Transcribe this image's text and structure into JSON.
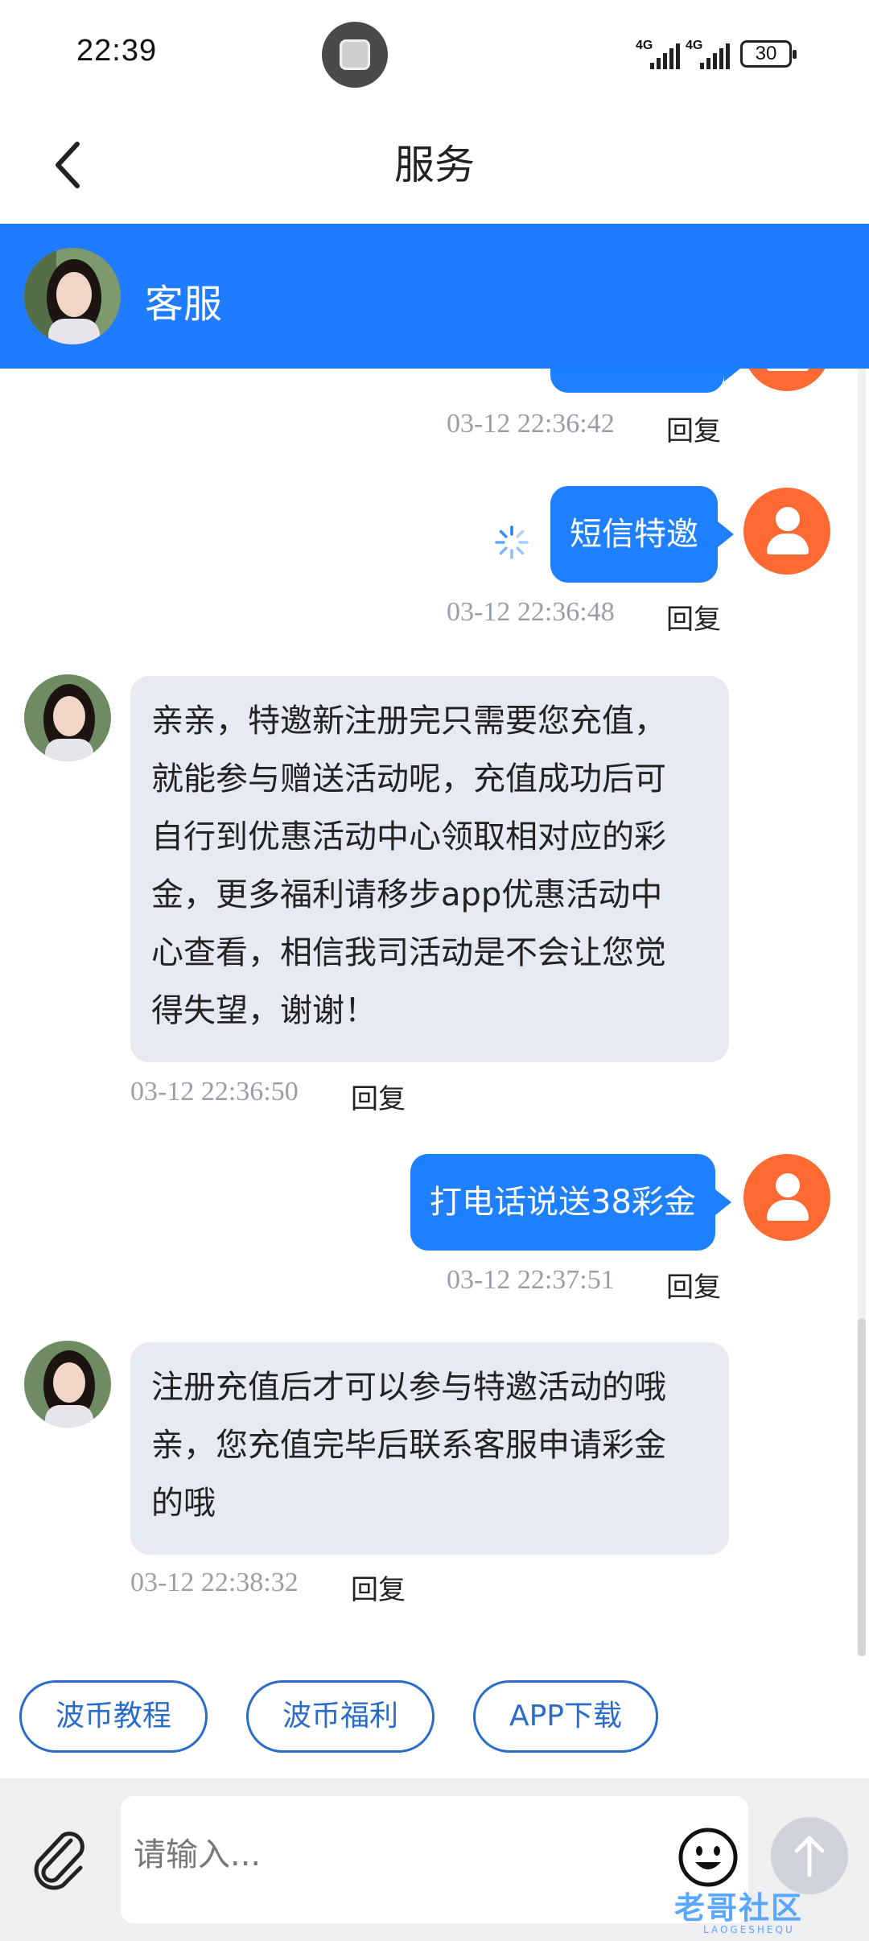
{
  "status_bar": {
    "time": "22:39",
    "signal_1": "4G",
    "signal_2": "4G",
    "battery": "30"
  },
  "header": {
    "title": "服务"
  },
  "service": {
    "name": "客服"
  },
  "messages": [
    {
      "direction": "outgoing",
      "text": "",
      "timestamp": "03-12 22:36:42",
      "reply": "回复"
    },
    {
      "direction": "outgoing",
      "text": "短信特邀",
      "timestamp": "03-12 22:36:48",
      "reply": "回复",
      "status": "sending"
    },
    {
      "direction": "incoming",
      "lines": [
        "亲亲，特邀新注册完只需要您充值，",
        "就能参与赠送活动呢，充值成功后可",
        "自行到优惠活动中心领取相对应的彩",
        "金，更多福利请移步app优惠活动中",
        "心查看，相信我司活动是不会让您觉",
        "得失望，谢谢！"
      ],
      "timestamp": "03-12 22:36:50",
      "reply": "回复"
    },
    {
      "direction": "outgoing",
      "text": "打电话说送38彩金",
      "timestamp": "03-12 22:37:51",
      "reply": "回复"
    },
    {
      "direction": "incoming",
      "lines": [
        "注册充值后才可以参与特邀活动的哦",
        "亲，您充值完毕后联系客服申请彩金",
        "的哦"
      ],
      "timestamp": "03-12 22:38:32",
      "reply": "回复"
    }
  ],
  "quick_actions": [
    {
      "label": "波币教程"
    },
    {
      "label": "波币福利"
    },
    {
      "label": "APP下载"
    }
  ],
  "input": {
    "placeholder": "请输入..."
  },
  "watermark": {
    "text": "老哥社区",
    "sub": "LAOGESHEQU"
  },
  "colors": {
    "accent": "#1f7bff",
    "outgoing_bubble": "#1f80ff",
    "incoming_bubble": "#e6eaf2",
    "user_avatar": "#ff6a33",
    "quick_button": "#2b6cc8"
  }
}
